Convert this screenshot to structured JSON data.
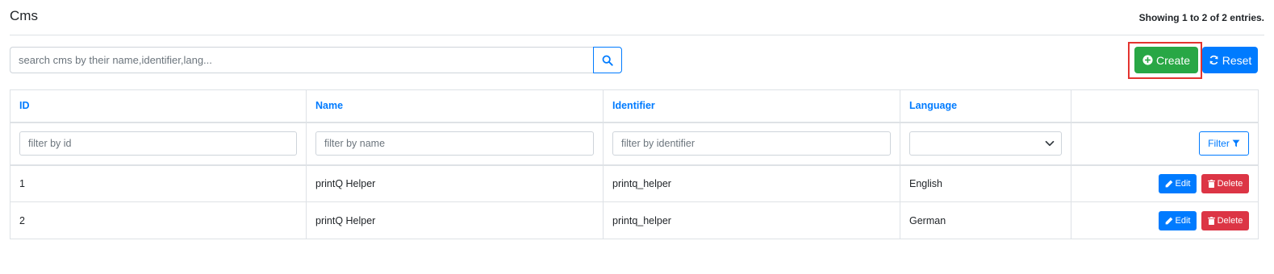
{
  "header": {
    "title": "Cms",
    "summary": "Showing 1 to 2 of 2 entries."
  },
  "search": {
    "placeholder": "search cms by their name,identifier,lang...",
    "value": "",
    "button_icon": "search-icon"
  },
  "toolbar": {
    "create_label": "Create",
    "create_icon": "plus-circle-icon",
    "reset_label": "Reset",
    "reset_icon": "refresh-icon",
    "create_color": "#28a745",
    "reset_color": "#007bff",
    "highlight_color": "#e3342f"
  },
  "table": {
    "columns": [
      "ID",
      "Name",
      "Identifier",
      "Language",
      ""
    ],
    "filters": {
      "id_placeholder": "filter by id",
      "name_placeholder": "filter by name",
      "identifier_placeholder": "filter by identifier",
      "language_selected": "",
      "filter_label": "Filter",
      "filter_icon": "funnel-icon"
    },
    "rows": [
      {
        "id": "1",
        "name": "printQ Helper",
        "identifier": "printq_helper",
        "language": "English"
      },
      {
        "id": "2",
        "name": "printQ Helper",
        "identifier": "printq_helper",
        "language": "German"
      }
    ],
    "row_actions": {
      "edit_label": "Edit",
      "edit_icon": "pencil-icon",
      "delete_label": "Delete",
      "delete_icon": "trash-icon"
    }
  }
}
